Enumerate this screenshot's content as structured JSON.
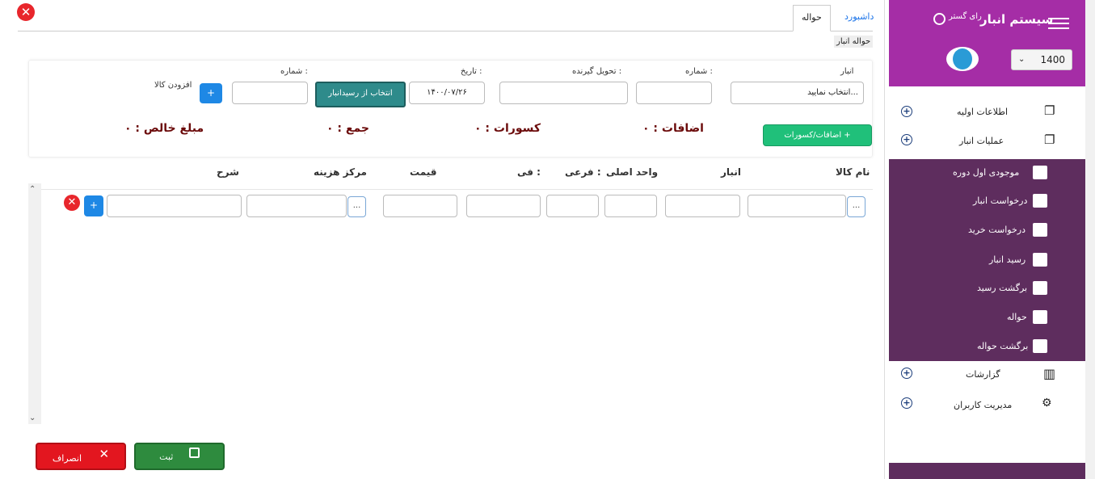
{
  "tabs": {
    "dashboard": "داشبورد",
    "current": "حواله"
  },
  "page_title": "حواله انبار",
  "form": {
    "anbar_label": "انبار",
    "anbar_value": "انتخاب نمایید...",
    "shomare_label": "شماره :",
    "tahvil_label": "تحویل گیرنده :",
    "tarikh_label": "تاریخ :",
    "tarikh_value": "۱۴۰۰/۰۷/۲۶",
    "select_receipt_button": "انتخاب از رسیدانبار",
    "shomare2_label": "شماره :",
    "add_item_label": "افزودن کالا",
    "add_item_button": "+",
    "adjustments_button": "اضافات/کسورات +"
  },
  "totals": {
    "ezafat": "اضافات :  ۰",
    "kosurat": "کسورات : ۰",
    "jam": "جمع : ۰",
    "mablagh": "مبلغ خالص : ۰"
  },
  "columns": [
    "نام کالا",
    "انبار",
    "واحد اصلی",
    "فرعی :",
    "فی :",
    "قیمت",
    "مرکز هزینه",
    "شرح"
  ],
  "row_buttons": {
    "dots": "...",
    "add": "+"
  },
  "actions": {
    "save": "ثبت",
    "cancel": "انصراف"
  },
  "sidebar": {
    "title": "سیستم انبار",
    "brand": "رای گستر",
    "year": "1400",
    "menu": [
      {
        "label": "اطلاعات اولیه",
        "icon": "copy-icon"
      },
      {
        "label": "عملیات انبار",
        "icon": "copy-icon"
      }
    ],
    "submenu": [
      "موجودی اول دوره",
      "درخواست انبار",
      "درخواست خرید",
      "رسید انبار",
      "برگشت رسید",
      "حواله",
      "برگشت حواله"
    ],
    "menu2": [
      {
        "label": "گزارشات",
        "icon": "chart-icon"
      },
      {
        "label": "مدیریت کاربران",
        "icon": "users-cog-icon"
      }
    ]
  },
  "colors": {
    "sidebar_header": "#a52da6",
    "sidebar_sub": "#5e2d5e",
    "save": "#2e8b3e",
    "cancel": "#e3161f",
    "green_btn": "#20c07a",
    "teal_btn": "#2e8b8b"
  }
}
